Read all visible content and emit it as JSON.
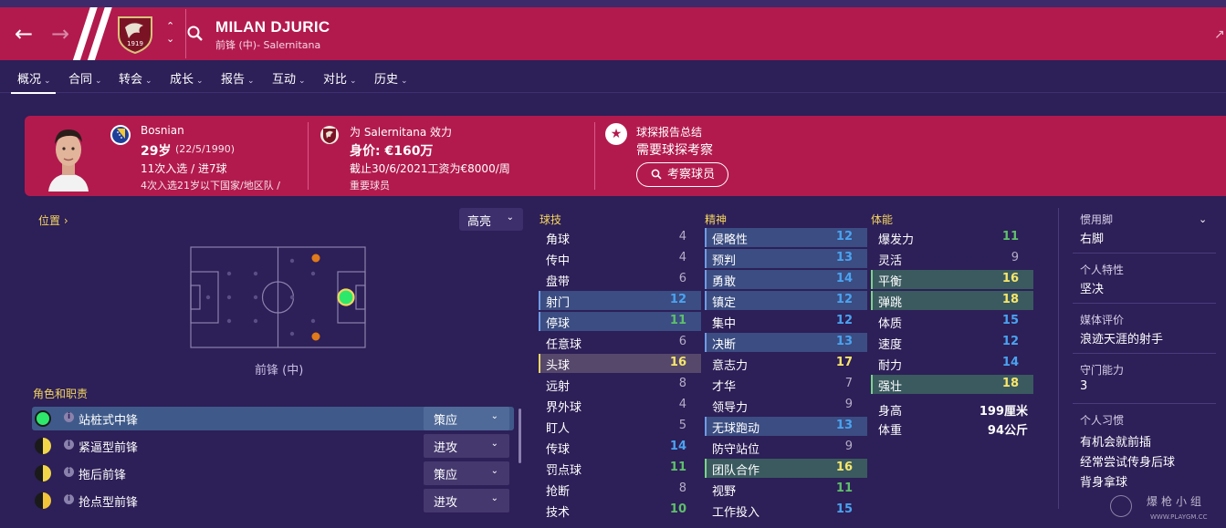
{
  "header": {
    "player_name": "MILAN DJURIC",
    "player_sub": "前锋 (中)- Salernitana",
    "crest_year": "1919",
    "icons": [
      "back-arrow-icon",
      "forward-arrow-icon",
      "club-crest-icon",
      "up-down-icon",
      "search-icon",
      "edit-icon"
    ]
  },
  "tabs": [
    {
      "label": "概况",
      "active": true
    },
    {
      "label": "合同"
    },
    {
      "label": "转会"
    },
    {
      "label": "成长"
    },
    {
      "label": "报告"
    },
    {
      "label": "互动"
    },
    {
      "label": "对比"
    },
    {
      "label": "历史"
    }
  ],
  "info": {
    "nationality": "Bosnian",
    "age": "29岁",
    "dob": "(22/5/1990)",
    "caps": "11次入选 / 进7球",
    "youth_caps": "4次入选21岁以下国家/地区队 /",
    "club_line": "为 Salernitana 效力",
    "value": "身价: €160万",
    "contract": "截止30/6/2021工资为€8000/周",
    "status": "重要球员",
    "scout_title": "球探报告总结",
    "scout_needed": "需要球探考察",
    "scout_button": "考察球员"
  },
  "left": {
    "position_label": "位置",
    "highlight": "高亮",
    "position_text": "前锋 (中)",
    "roles_label": "角色和职责",
    "roles": [
      {
        "name": "站桩式中锋",
        "duty": "策应",
        "dot_color": "#2ee86b"
      },
      {
        "name": "紧逼型前锋",
        "duty": "进攻",
        "dot_color": "#f1d64a"
      },
      {
        "name": "拖后前锋",
        "duty": "策应",
        "dot_color": "#f1d64a"
      },
      {
        "name": "抢点型前锋",
        "duty": "进攻",
        "dot_color": "#f1c43a"
      }
    ]
  },
  "attributes": {
    "technical_label": "球技",
    "mental_label": "精神",
    "physical_label": "体能",
    "technical": [
      {
        "name": "角球",
        "value": "4",
        "color": "grey"
      },
      {
        "name": "传中",
        "value": "4",
        "color": "grey"
      },
      {
        "name": "盘带",
        "value": "6",
        "color": "grey"
      },
      {
        "name": "射门",
        "value": "12",
        "color": "blue",
        "hl": "sel"
      },
      {
        "name": "停球",
        "value": "11",
        "color": "green",
        "hl": "sel"
      },
      {
        "name": "任意球",
        "value": "6",
        "color": "grey"
      },
      {
        "name": "头球",
        "value": "16",
        "color": "yellow",
        "hl": "sel-y"
      },
      {
        "name": "远射",
        "value": "8",
        "color": "grey"
      },
      {
        "name": "界外球",
        "value": "4",
        "color": "grey"
      },
      {
        "name": "盯人",
        "value": "5",
        "color": "grey"
      },
      {
        "name": "传球",
        "value": "14",
        "color": "blue"
      },
      {
        "name": "罚点球",
        "value": "11",
        "color": "green"
      },
      {
        "name": "抢断",
        "value": "8",
        "color": "grey"
      },
      {
        "name": "技术",
        "value": "10",
        "color": "green"
      }
    ],
    "mental": [
      {
        "name": "侵略性",
        "value": "12",
        "color": "blue",
        "hl": "sel"
      },
      {
        "name": "预判",
        "value": "13",
        "color": "blue",
        "hl": "sel"
      },
      {
        "name": "勇敢",
        "value": "14",
        "color": "blue",
        "hl": "sel"
      },
      {
        "name": "镇定",
        "value": "12",
        "color": "blue",
        "hl": "sel"
      },
      {
        "name": "集中",
        "value": "12",
        "color": "blue"
      },
      {
        "name": "决断",
        "value": "13",
        "color": "blue",
        "hl": "sel"
      },
      {
        "name": "意志力",
        "value": "17",
        "color": "yellow"
      },
      {
        "name": "才华",
        "value": "7",
        "color": "grey"
      },
      {
        "name": "领导力",
        "value": "9",
        "color": "grey"
      },
      {
        "name": "无球跑动",
        "value": "13",
        "color": "blue",
        "hl": "sel"
      },
      {
        "name": "防守站位",
        "value": "9",
        "color": "grey"
      },
      {
        "name": "团队合作",
        "value": "16",
        "color": "yellow",
        "hl": "sel-g"
      },
      {
        "name": "视野",
        "value": "11",
        "color": "green"
      },
      {
        "name": "工作投入",
        "value": "15",
        "color": "blue"
      }
    ],
    "physical": [
      {
        "name": "爆发力",
        "value": "11",
        "color": "green"
      },
      {
        "name": "灵活",
        "value": "9",
        "color": "grey"
      },
      {
        "name": "平衡",
        "value": "16",
        "color": "yellow",
        "hl": "sel-g"
      },
      {
        "name": "弹跳",
        "value": "18",
        "color": "yellow",
        "hl": "sel-g"
      },
      {
        "name": "体质",
        "value": "15",
        "color": "blue"
      },
      {
        "name": "速度",
        "value": "12",
        "color": "blue"
      },
      {
        "name": "耐力",
        "value": "14",
        "color": "blue"
      },
      {
        "name": "强壮",
        "value": "18",
        "color": "yellow",
        "hl": "sel-g"
      }
    ],
    "height_label": "身高",
    "height_value": "199厘米",
    "weight_label": "体重",
    "weight_value": "94公斤"
  },
  "right": {
    "foot_label": "惯用脚",
    "foot_value": "右脚",
    "trait_label": "个人特性",
    "trait_value": "坚决",
    "media_label": "媒体评价",
    "media_value": "浪迹天涯的射手",
    "gk_label": "守门能力",
    "gk_value": "3",
    "habits_label": "个人习惯",
    "habits": [
      "有机会就前插",
      "经常尝试传身后球",
      "背身拿球"
    ]
  },
  "watermark": {
    "text": "爆枪小组",
    "sub": "WWW.PLAYGM.CC"
  }
}
